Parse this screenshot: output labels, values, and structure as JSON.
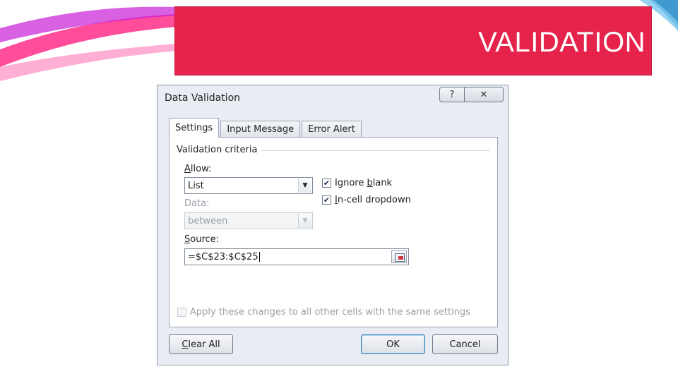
{
  "slide": {
    "title": "VALIDATION"
  },
  "dialog": {
    "title": "Data Validation",
    "help_label": "?",
    "close_label": "✕",
    "tabs": [
      {
        "label": "Settings"
      },
      {
        "label": "Input Message"
      },
      {
        "label": "Error Alert"
      }
    ],
    "criteria_legend": "Validation criteria",
    "allow": {
      "label_key": "A",
      "label_rest": "llow:",
      "value": "List"
    },
    "data": {
      "label": "Data:",
      "value": "between"
    },
    "ignore_blank": {
      "label_pre": "Ignore ",
      "label_key": "b",
      "label_post": "lank",
      "checked": true
    },
    "incell_dropdown": {
      "label_key": "I",
      "label_post": "n-cell dropdown",
      "checked": true
    },
    "source": {
      "label_key": "S",
      "label_rest": "ource:",
      "value": "=$C$23:$C$25"
    },
    "apply_all": {
      "label": "Apply these changes to all other cells with the same settings",
      "checked": false
    },
    "buttons": {
      "clear_all_key": "C",
      "clear_all_rest": "lear All",
      "ok": "OK",
      "cancel": "Cancel"
    }
  },
  "colors": {
    "title_bar": "#e5234b",
    "dialog_bg": "#e9ecf2",
    "accent": "#3c7fb1"
  }
}
